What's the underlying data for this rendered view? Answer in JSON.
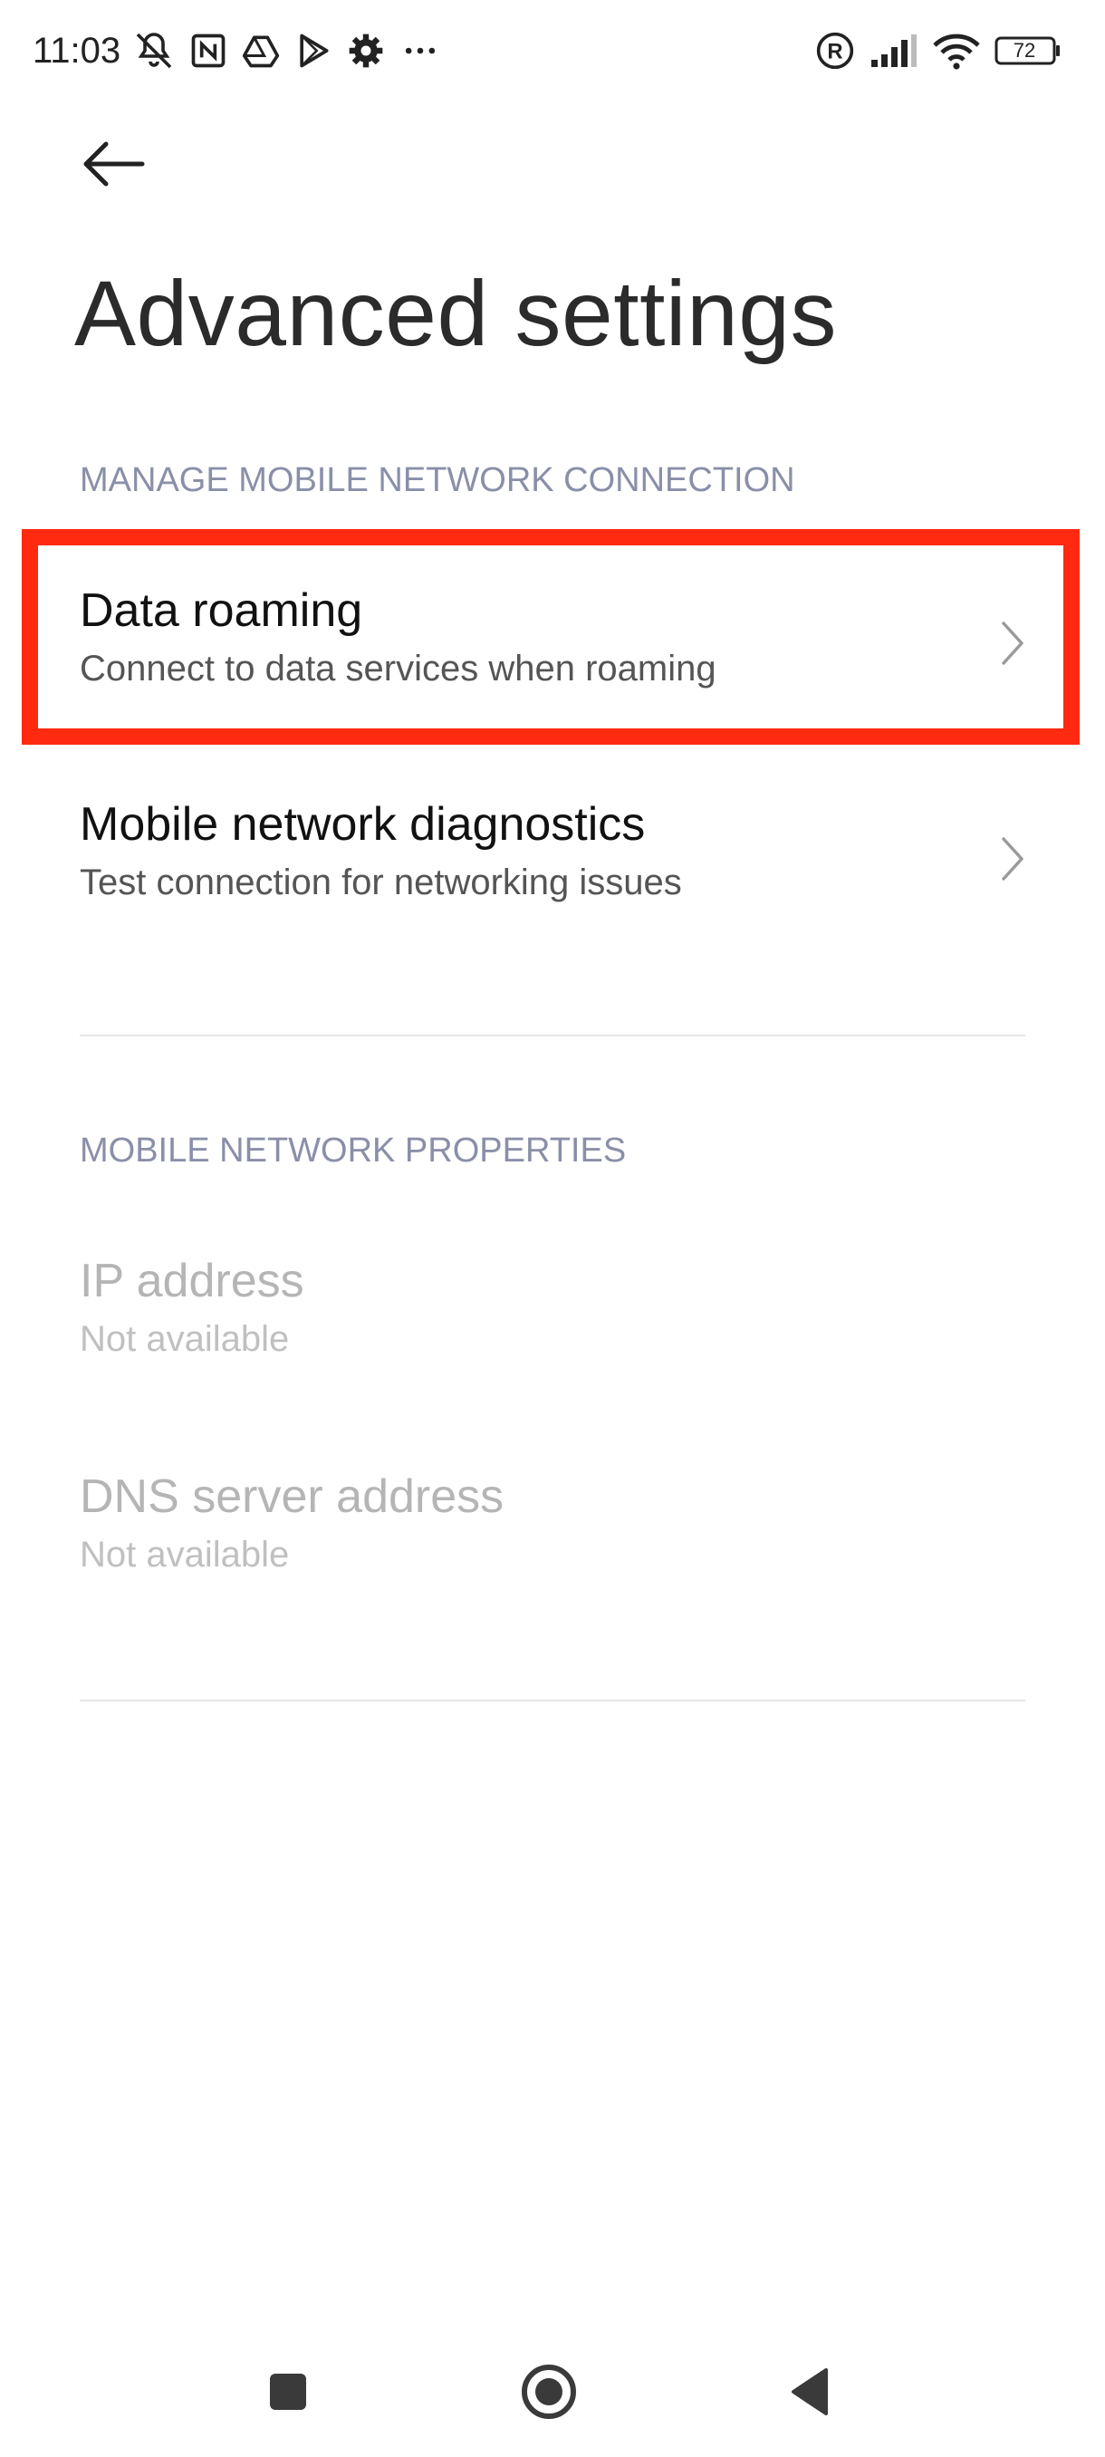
{
  "status_bar": {
    "time": "11:03",
    "left_icons": [
      "mute-icon",
      "nfc-icon",
      "drive-icon",
      "play-store-icon",
      "settings-gear-icon",
      "more-dots-icon"
    ],
    "right_icons": [
      "registered-roaming-icon",
      "signal-icon",
      "wifi-icon",
      "battery-icon"
    ],
    "battery_level": "72"
  },
  "header": {
    "back_icon": "arrow-left-icon",
    "title": "Advanced settings"
  },
  "sections": {
    "manage": {
      "header": "MANAGE MOBILE NETWORK CONNECTION",
      "items": [
        {
          "title": "Data roaming",
          "subtitle": "Connect to data services when roaming"
        },
        {
          "title": "Mobile network diagnostics",
          "subtitle": "Test connection for networking issues"
        }
      ]
    },
    "properties": {
      "header": "MOBILE NETWORK PROPERTIES",
      "items": [
        {
          "title": "IP address",
          "subtitle": "Not available"
        },
        {
          "title": "DNS server address",
          "subtitle": "Not available"
        }
      ]
    }
  },
  "colors": {
    "highlight": "#ff2a10",
    "section_header": "#8a8fa8",
    "disabled_text": "#b5b5b5"
  },
  "nav_bar": {
    "icons": [
      "recents-square-icon",
      "home-circle-icon",
      "back-triangle-icon"
    ]
  }
}
